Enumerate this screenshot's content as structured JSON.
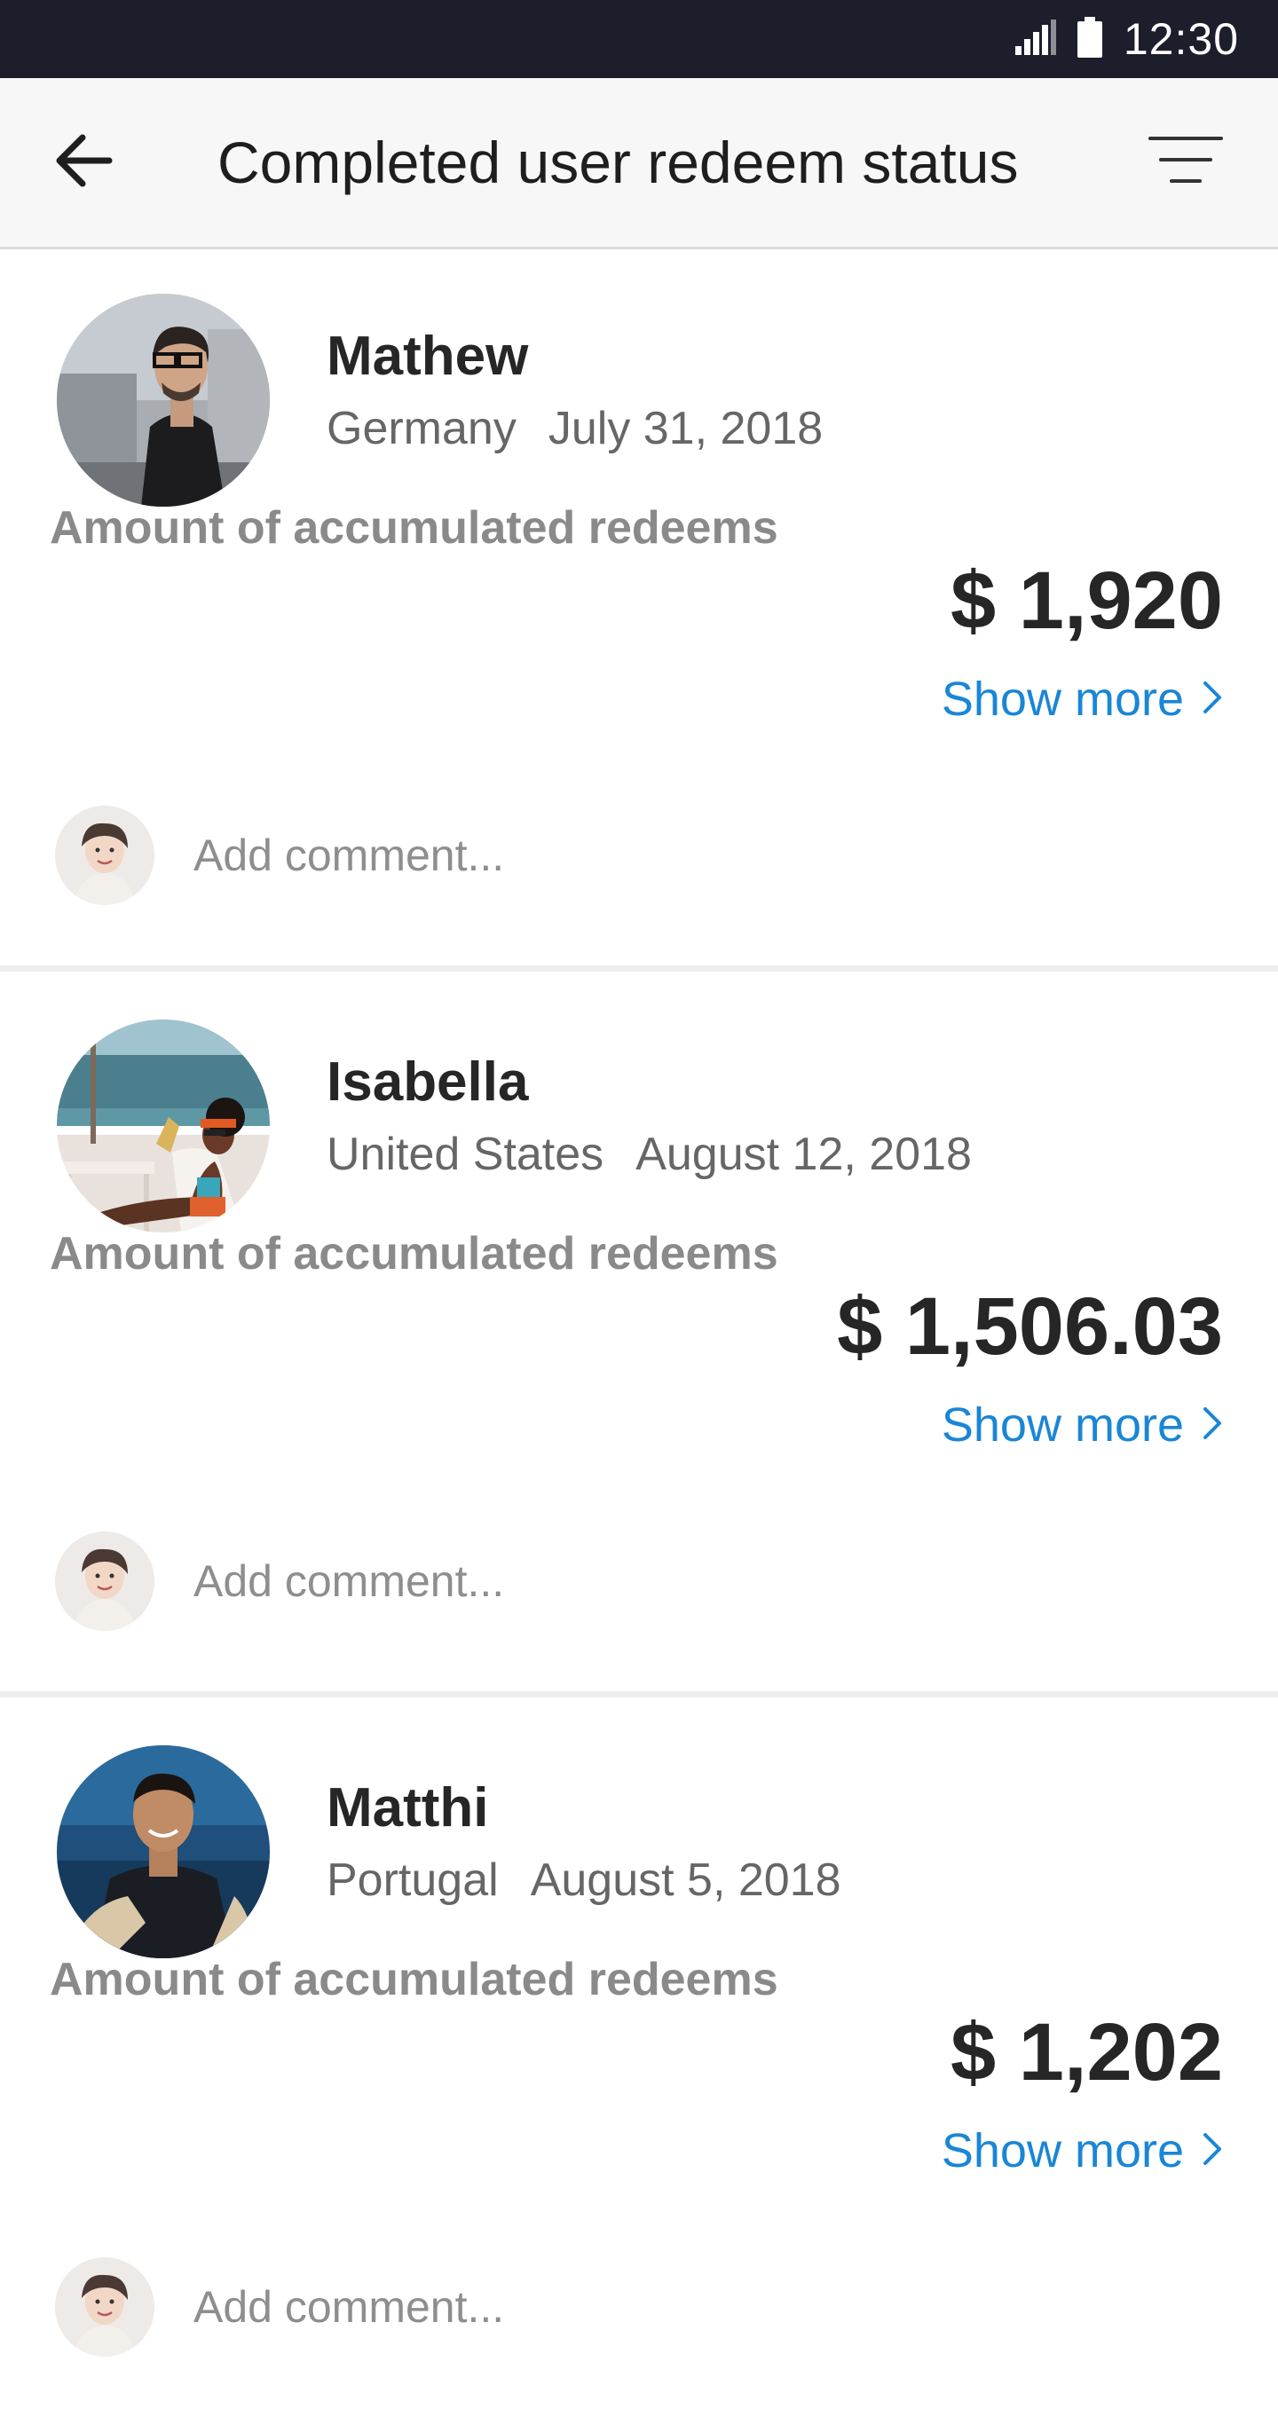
{
  "status_bar": {
    "time": "12:30",
    "icons": [
      "signal-icon",
      "battery-icon"
    ]
  },
  "app_bar": {
    "title": "Completed user redeem status",
    "back_icon": "arrow-left-icon",
    "filter_icon": "filter-icon"
  },
  "cards": [
    {
      "name": "Mathew",
      "country": "Germany",
      "date": "July 31, 2018",
      "amount_label": "Amount of accumulated redeems",
      "amount": "$ 1,920",
      "show_more": "Show more",
      "comment_placeholder": "Add comment..."
    },
    {
      "name": "Isabella",
      "country": "United States",
      "date": "August 12, 2018",
      "amount_label": "Amount of accumulated redeems",
      "amount": "$ 1,506.03",
      "show_more": "Show more",
      "comment_placeholder": "Add comment..."
    },
    {
      "name": "Matthi",
      "country": "Portugal",
      "date": "August 5, 2018",
      "amount_label": "Amount of accumulated redeems",
      "amount": "$ 1,202",
      "show_more": "Show more",
      "comment_placeholder": "Add comment..."
    }
  ],
  "colors": {
    "status_bar": "#1d1e2c",
    "app_bar": "#f7f7f7",
    "link": "#1a86d6",
    "text_primary": "#262626",
    "text_secondary": "#666666"
  }
}
